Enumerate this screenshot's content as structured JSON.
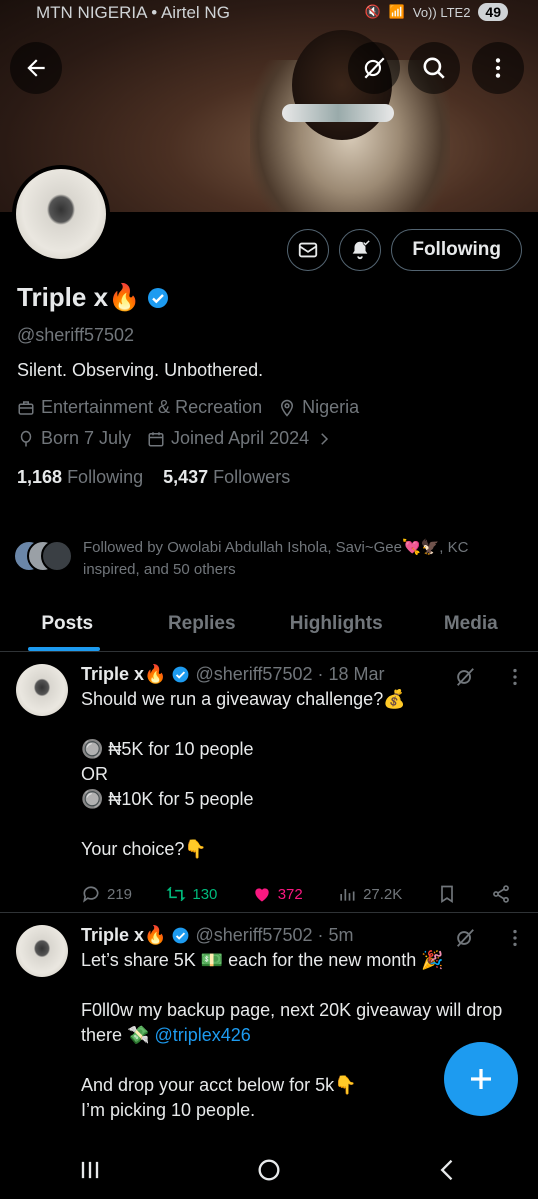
{
  "status_bar": {
    "carrier": "MTN NIGERIA • Airtel NG",
    "network": "Vo)) LTE2",
    "battery": "49"
  },
  "profile": {
    "name": "Triple x🔥",
    "handle": "@sheriff57502",
    "bio": "Silent. Observing. Unbothered.",
    "category": "Entertainment & Recreation",
    "location": "Nigeria",
    "born": "Born 7 July",
    "joined": "Joined April 2024",
    "following_count": "1,168",
    "following_label": "Following",
    "followers_count": "5,437",
    "followers_label": "Followers",
    "followed_by": "Followed by Owolabi Abdullah Ishola, Savi~Gee💘🦅, KC inspired, and 50 others",
    "follow_button": "Following"
  },
  "tabs": [
    {
      "label": "Posts",
      "active": true
    },
    {
      "label": "Replies",
      "active": false
    },
    {
      "label": "Highlights",
      "active": false
    },
    {
      "label": "Media",
      "active": false
    }
  ],
  "tweets": [
    {
      "author": "Triple x🔥",
      "handle": "@sheriff57502",
      "time": "· 18 Mar",
      "text": "Should we run a giveaway challenge?💰\n\n🔘 ₦5K for 10 people\n            OR\n🔘 ₦10K for 5 people\n\nYour choice?👇",
      "replies": "219",
      "reposts": "130",
      "likes": "372",
      "views": "27.2K"
    },
    {
      "author": "Triple x🔥",
      "handle": "@sheriff57502",
      "time": "· 5m",
      "text_a": "Let’s share 5K 💵 each for the new month 🎉\n\nF0ll0w my backup page, next 20K giveaway will drop there 💸 ",
      "link": "@triplex426",
      "text_b": "\n\nAnd drop your acct below for 5k👇\nI’m picking 10 people."
    }
  ],
  "colors": {
    "accent": "#1d9bf0",
    "like": "#f91880",
    "repost": "#00ba7c",
    "muted": "#71767b",
    "border": "#2f3336"
  }
}
